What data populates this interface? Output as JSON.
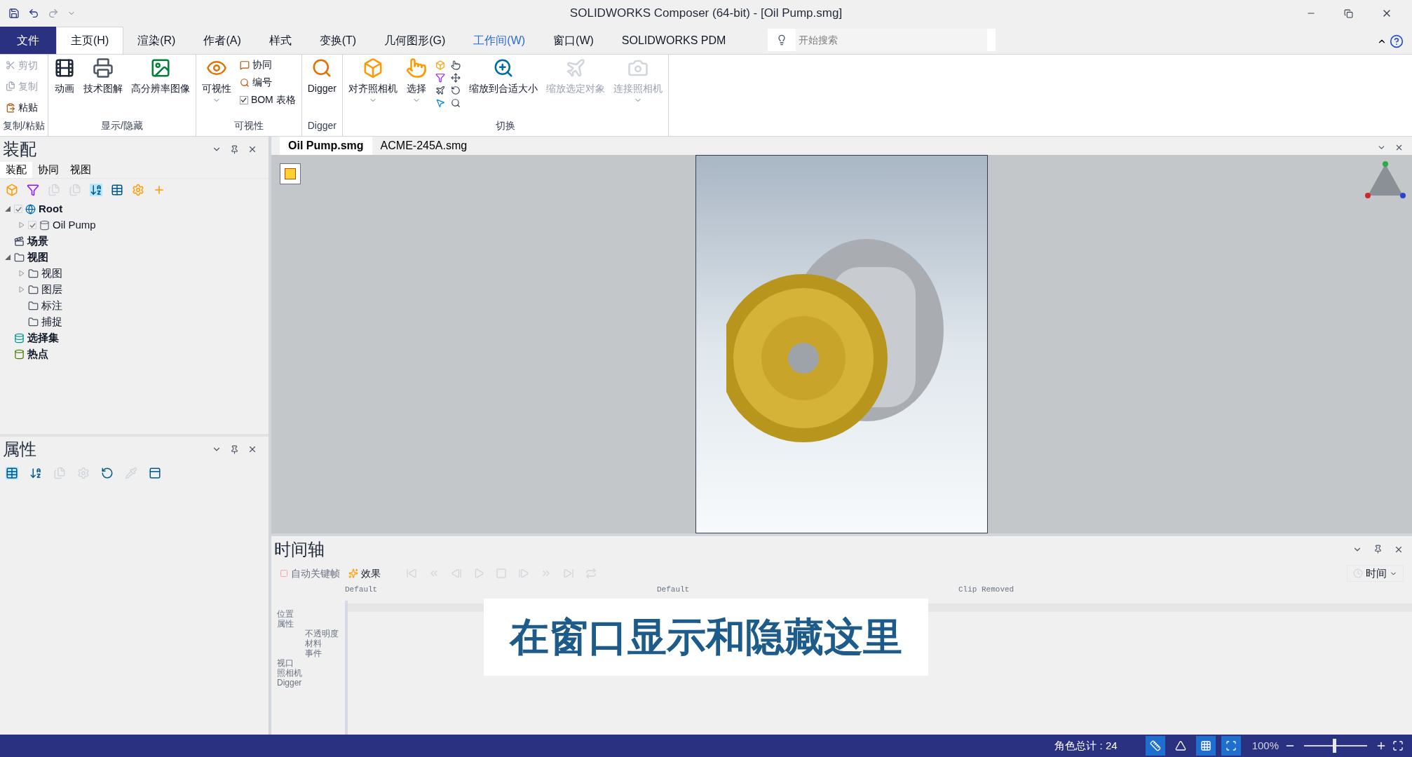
{
  "window": {
    "title": "SOLIDWORKS Composer (64-bit) - [Oil Pump.smg]"
  },
  "menu_tabs": [
    {
      "label": "文件",
      "kind": "file",
      "selected": false
    },
    {
      "label": "主页(H)",
      "kind": "tab",
      "selected": true
    },
    {
      "label": "渲染(R)",
      "kind": "tab",
      "selected": false
    },
    {
      "label": "作者(A)",
      "kind": "tab",
      "selected": false
    },
    {
      "label": "样式",
      "kind": "tab",
      "selected": false
    },
    {
      "label": "变换(T)",
      "kind": "tab",
      "selected": false
    },
    {
      "label": "几何图形(G)",
      "kind": "tab",
      "selected": false
    },
    {
      "label": "工作间(W)",
      "kind": "accent",
      "selected": false
    },
    {
      "label": "窗口(W)",
      "kind": "tab",
      "selected": false
    },
    {
      "label": "SOLIDWORKS PDM",
      "kind": "tab",
      "selected": false
    }
  ],
  "search": {
    "placeholder": "开始搜索"
  },
  "ribbon": [
    {
      "label": "复制/粘贴",
      "items": [
        {
          "label": "剪切",
          "kind": "small",
          "disabled": true
        },
        {
          "label": "复制",
          "kind": "small",
          "disabled": true
        },
        {
          "label": "粘贴",
          "kind": "small",
          "disabled": false
        }
      ]
    },
    {
      "label": "显示/隐藏",
      "items": [
        {
          "label": "动画",
          "kind": "large",
          "disabled": false,
          "dropdown": false
        },
        {
          "label": "技术图解",
          "kind": "large",
          "disabled": false,
          "dropdown": false
        },
        {
          "label": "高分辨率图像",
          "kind": "large",
          "disabled": false,
          "dropdown": false
        }
      ]
    },
    {
      "label": "可视性",
      "items": [
        {
          "label": "可视性",
          "kind": "large",
          "disabled": false,
          "dropdown": true
        },
        {
          "label": "协同",
          "kind": "small",
          "disabled": false
        },
        {
          "label": "编号",
          "kind": "small",
          "disabled": false
        },
        {
          "label": "BOM 表格",
          "kind": "check",
          "disabled": false,
          "checked": true
        }
      ]
    },
    {
      "label": "Digger",
      "items": [
        {
          "label": "Digger",
          "kind": "large",
          "disabled": false,
          "dropdown": false
        }
      ]
    },
    {
      "label": "切换",
      "items": [
        {
          "label": "对齐照相机",
          "kind": "large",
          "disabled": false,
          "dropdown": true
        },
        {
          "label": "选择",
          "kind": "large",
          "disabled": false,
          "dropdown": true
        },
        {
          "kind": "grid",
          "disabled": false
        },
        {
          "label": "缩放到合适大小",
          "kind": "large",
          "disabled": false,
          "dropdown": false
        },
        {
          "label": "缩放选定对象",
          "kind": "large",
          "disabled": true,
          "dropdown": false
        },
        {
          "label": "连接照相机",
          "kind": "large",
          "disabled": true,
          "dropdown": true
        }
      ]
    }
  ],
  "assembly_panel": {
    "title": "装配",
    "tabs": [
      {
        "label": "装配",
        "selected": true
      },
      {
        "label": "协同",
        "selected": false
      },
      {
        "label": "视图",
        "selected": false
      }
    ],
    "tree": [
      {
        "label": "Root",
        "kind": "globe",
        "checked": true,
        "expanded": true,
        "children": [
          {
            "label": "Oil Pump",
            "kind": "part",
            "checked": true,
            "expanded": false
          }
        ]
      },
      {
        "label": "场景",
        "kind": "scene"
      },
      {
        "label": "视图",
        "kind": "folder",
        "expanded": true,
        "children": [
          {
            "label": "视图",
            "kind": "folder",
            "expanded": false
          },
          {
            "label": "图层",
            "kind": "folder",
            "expanded": false
          },
          {
            "label": "标注",
            "kind": "folder"
          },
          {
            "label": "捕捉",
            "kind": "folder"
          }
        ]
      },
      {
        "label": "选择集",
        "kind": "selection"
      },
      {
        "label": "热点",
        "kind": "hotspot"
      }
    ]
  },
  "properties_panel": {
    "title": "属性"
  },
  "documents": [
    {
      "label": "Oil Pump.smg",
      "selected": true
    },
    {
      "label": "ACME-245A.smg",
      "selected": false
    }
  ],
  "timeline": {
    "title": "时间轴",
    "toolbar": [
      {
        "label": "自动关键帧",
        "disabled": true
      },
      {
        "label": "效果",
        "disabled": false
      }
    ],
    "mode": "时间",
    "tracks": [
      "Default",
      "Default",
      "Clip Removed"
    ],
    "labels": [
      {
        "label": "位置"
      },
      {
        "label": "属性",
        "children": [
          {
            "label": "不透明度"
          },
          {
            "label": "材料"
          },
          {
            "label": "事件"
          }
        ]
      },
      {
        "label": "视口"
      },
      {
        "label": "照相机"
      },
      {
        "label": "Digger"
      }
    ]
  },
  "caption": "在窗口显示和隐藏这里",
  "status_bar": {
    "count": "角色总计 : 24",
    "toggles": [
      {
        "on": true
      },
      {
        "on": false
      },
      {
        "on": true
      },
      {
        "on": true
      }
    ],
    "zoom": "100%",
    "zoom_slider": {
      "level": 0.48
    }
  }
}
